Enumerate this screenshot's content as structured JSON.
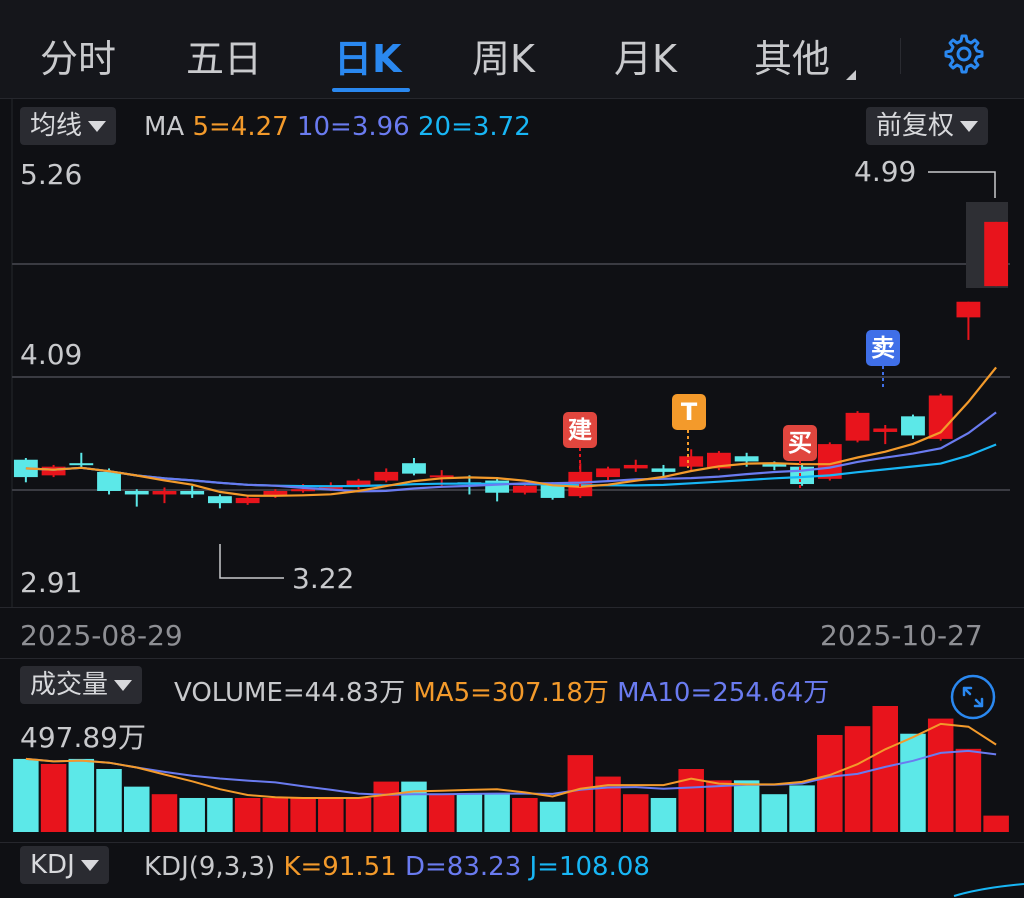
{
  "tabs": [
    {
      "label": "分时",
      "active": false
    },
    {
      "label": "五日",
      "active": false
    },
    {
      "label": "日K",
      "active": true
    },
    {
      "label": "周K",
      "active": false
    },
    {
      "label": "月K",
      "active": false
    },
    {
      "label": "其他",
      "active": false
    }
  ],
  "settings_icon": "gear-icon",
  "colors": {
    "accent": "#2a88f0",
    "up": "#e8141c",
    "down": "#5ce8e8",
    "ma5": "#f39a2b",
    "ma10": "#6a7bf0",
    "ma20": "#18b6f5"
  },
  "main_chart": {
    "indicator_select": "均线",
    "ma_label": "MA",
    "ma5": "5=4.27",
    "ma10": "10=3.96",
    "ma20": "20=3.72",
    "adjust_select": "前复权",
    "y_top": "5.26",
    "y_mid": "4.09",
    "y_bottom": "2.91",
    "high_label": "4.99",
    "low_label": "3.22",
    "start_date": "2025-08-29",
    "end_date": "2025-10-27",
    "signals": {
      "build": "建",
      "t": "T",
      "buy": "买",
      "sell": "卖"
    }
  },
  "volume_chart": {
    "indicator_select": "成交量",
    "volume": "VOLUME=44.83万",
    "ma5": "MA5=307.18万",
    "ma10": "MA10=254.64万",
    "max_label": "497.89万",
    "expand_icon": "expand-icon"
  },
  "kdj": {
    "indicator_select": "KDJ",
    "params": "KDJ(9,3,3)",
    "k": "K=91.51",
    "d": "D=83.23",
    "j": "J=108.08"
  },
  "chart_data": {
    "type": "candlestick",
    "y_range": [
      2.91,
      5.26
    ],
    "candles": [
      {
        "o": 3.52,
        "c": 3.62,
        "h": 3.63,
        "l": 3.49,
        "dir": "down"
      },
      {
        "o": 3.53,
        "c": 3.58,
        "h": 3.59,
        "l": 3.52,
        "dir": "up"
      },
      {
        "o": 3.6,
        "c": 3.59,
        "h": 3.66,
        "l": 3.57,
        "dir": "down"
      },
      {
        "o": 3.55,
        "c": 3.44,
        "h": 3.57,
        "l": 3.42,
        "dir": "down"
      },
      {
        "o": 3.44,
        "c": 3.42,
        "h": 3.45,
        "l": 3.35,
        "dir": "down"
      },
      {
        "o": 3.42,
        "c": 3.44,
        "h": 3.46,
        "l": 3.37,
        "dir": "up"
      },
      {
        "o": 3.44,
        "c": 3.42,
        "h": 3.47,
        "l": 3.4,
        "dir": "down"
      },
      {
        "o": 3.41,
        "c": 3.37,
        "h": 3.42,
        "l": 3.34,
        "dir": "down"
      },
      {
        "o": 3.37,
        "c": 3.4,
        "h": 3.41,
        "l": 3.36,
        "dir": "up"
      },
      {
        "o": 3.41,
        "c": 3.44,
        "h": 3.45,
        "l": 3.4,
        "dir": "up"
      },
      {
        "o": 3.44,
        "c": 3.45,
        "h": 3.48,
        "l": 3.43,
        "dir": "up"
      },
      {
        "o": 3.45,
        "c": 3.47,
        "h": 3.49,
        "l": 3.44,
        "dir": "up"
      },
      {
        "o": 3.47,
        "c": 3.5,
        "h": 3.51,
        "l": 3.45,
        "dir": "up"
      },
      {
        "o": 3.5,
        "c": 3.55,
        "h": 3.57,
        "l": 3.49,
        "dir": "up"
      },
      {
        "o": 3.54,
        "c": 3.6,
        "h": 3.63,
        "l": 3.53,
        "dir": "down"
      },
      {
        "o": 3.52,
        "c": 3.53,
        "h": 3.56,
        "l": 3.47,
        "dir": "up"
      },
      {
        "o": 3.48,
        "c": 3.49,
        "h": 3.53,
        "l": 3.42,
        "dir": "down"
      },
      {
        "o": 3.43,
        "c": 3.5,
        "h": 3.52,
        "l": 3.38,
        "dir": "down"
      },
      {
        "o": 3.47,
        "c": 3.43,
        "h": 3.48,
        "l": 3.42,
        "dir": "up"
      },
      {
        "o": 3.4,
        "c": 3.48,
        "h": 3.49,
        "l": 3.39,
        "dir": "down"
      },
      {
        "o": 3.41,
        "c": 3.55,
        "h": 3.6,
        "l": 3.4,
        "dir": "up"
      },
      {
        "o": 3.52,
        "c": 3.57,
        "h": 3.58,
        "l": 3.5,
        "dir": "up"
      },
      {
        "o": 3.57,
        "c": 3.59,
        "h": 3.62,
        "l": 3.55,
        "dir": "up"
      },
      {
        "o": 3.55,
        "c": 3.57,
        "h": 3.59,
        "l": 3.52,
        "dir": "down"
      },
      {
        "o": 3.58,
        "c": 3.64,
        "h": 3.68,
        "l": 3.56,
        "dir": "up"
      },
      {
        "o": 3.57,
        "c": 3.66,
        "h": 3.67,
        "l": 3.56,
        "dir": "up"
      },
      {
        "o": 3.61,
        "c": 3.64,
        "h": 3.66,
        "l": 3.58,
        "dir": "down"
      },
      {
        "o": 3.58,
        "c": 3.6,
        "h": 3.61,
        "l": 3.56,
        "dir": "down"
      },
      {
        "o": 3.48,
        "c": 3.58,
        "h": 3.6,
        "l": 3.47,
        "dir": "down"
      },
      {
        "o": 3.51,
        "c": 3.71,
        "h": 3.72,
        "l": 3.5,
        "dir": "up"
      },
      {
        "o": 3.73,
        "c": 3.89,
        "h": 3.9,
        "l": 3.72,
        "dir": "up"
      },
      {
        "o": 3.78,
        "c": 3.8,
        "h": 3.82,
        "l": 3.71,
        "dir": "up"
      },
      {
        "o": 3.76,
        "c": 3.87,
        "h": 3.88,
        "l": 3.74,
        "dir": "down"
      },
      {
        "o": 3.74,
        "c": 3.99,
        "h": 4.0,
        "l": 3.73,
        "dir": "up"
      },
      {
        "o": 4.44,
        "c": 4.53,
        "h": 4.53,
        "l": 4.31,
        "dir": "up"
      },
      {
        "o": 4.62,
        "c": 4.99,
        "h": 4.99,
        "l": 4.62,
        "dir": "up"
      }
    ],
    "volume_bars": [
      {
        "dir": "down",
        "frac": 0.58
      },
      {
        "dir": "up",
        "frac": 0.54
      },
      {
        "dir": "down",
        "frac": 0.58
      },
      {
        "dir": "down",
        "frac": 0.5
      },
      {
        "dir": "down",
        "frac": 0.36
      },
      {
        "dir": "up",
        "frac": 0.3
      },
      {
        "dir": "down",
        "frac": 0.27
      },
      {
        "dir": "down",
        "frac": 0.27
      },
      {
        "dir": "up",
        "frac": 0.27
      },
      {
        "dir": "up",
        "frac": 0.27
      },
      {
        "dir": "up",
        "frac": 0.27
      },
      {
        "dir": "up",
        "frac": 0.27
      },
      {
        "dir": "up",
        "frac": 0.27
      },
      {
        "dir": "up",
        "frac": 0.4
      },
      {
        "dir": "down",
        "frac": 0.4
      },
      {
        "dir": "up",
        "frac": 0.3
      },
      {
        "dir": "down",
        "frac": 0.3
      },
      {
        "dir": "down",
        "frac": 0.3
      },
      {
        "dir": "up",
        "frac": 0.27
      },
      {
        "dir": "down",
        "frac": 0.24
      },
      {
        "dir": "up",
        "frac": 0.61
      },
      {
        "dir": "up",
        "frac": 0.44
      },
      {
        "dir": "up",
        "frac": 0.3
      },
      {
        "dir": "down",
        "frac": 0.27
      },
      {
        "dir": "up",
        "frac": 0.5
      },
      {
        "dir": "up",
        "frac": 0.41
      },
      {
        "dir": "down",
        "frac": 0.41
      },
      {
        "dir": "down",
        "frac": 0.3
      },
      {
        "dir": "down",
        "frac": 0.37
      },
      {
        "dir": "up",
        "frac": 0.77
      },
      {
        "dir": "up",
        "frac": 0.84
      },
      {
        "dir": "up",
        "frac": 1.0
      },
      {
        "dir": "down",
        "frac": 0.78
      },
      {
        "dir": "up",
        "frac": 0.9
      },
      {
        "dir": "up",
        "frac": 0.66
      },
      {
        "dir": "up",
        "frac": 0.13
      }
    ]
  }
}
